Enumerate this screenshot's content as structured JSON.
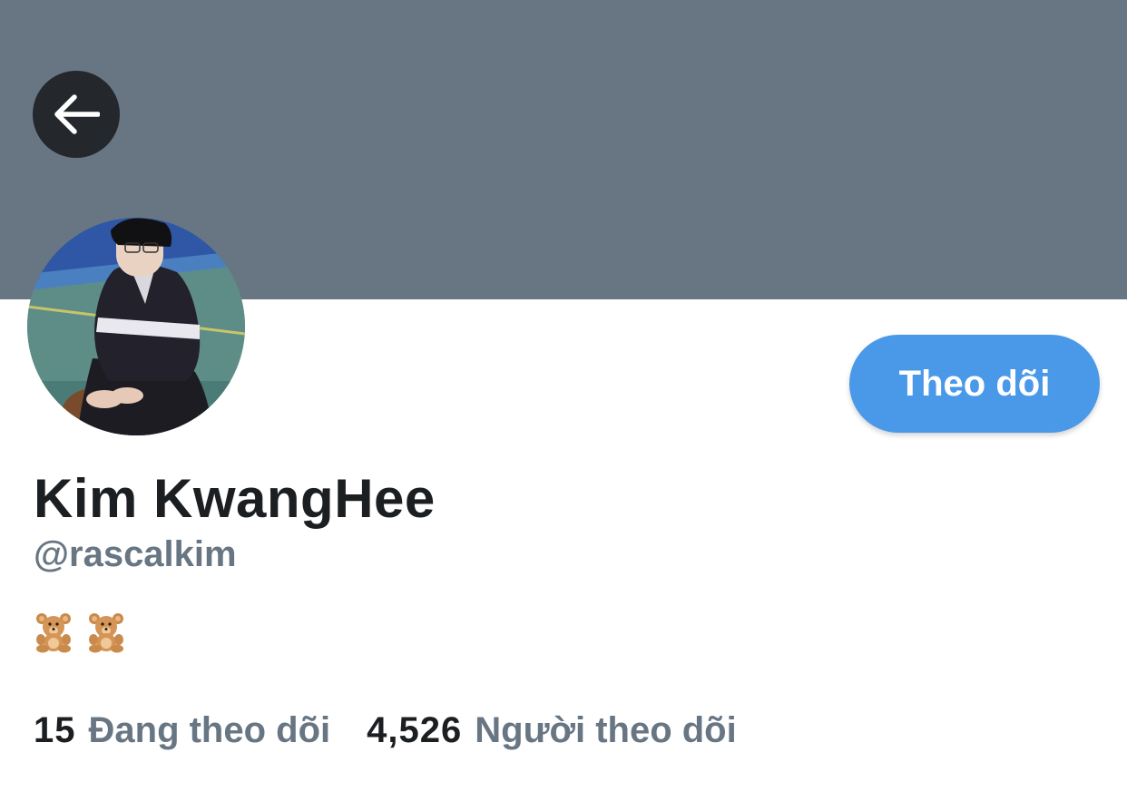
{
  "header": {
    "banner_color": "#687684",
    "back_icon": "arrow-left-icon"
  },
  "profile": {
    "display_name": "Kim KwangHee",
    "handle": "@rascalkim",
    "bio_emojis": [
      "🧸",
      "🧸"
    ],
    "avatar": "profile-photo-person-crouching-on-court"
  },
  "actions": {
    "follow_label": "Theo dõi",
    "follow_color": "#4a99e9"
  },
  "stats": {
    "following_count": "15",
    "following_label": "Đang theo dõi",
    "followers_count": "4,526",
    "followers_label": "Người theo dõi"
  }
}
